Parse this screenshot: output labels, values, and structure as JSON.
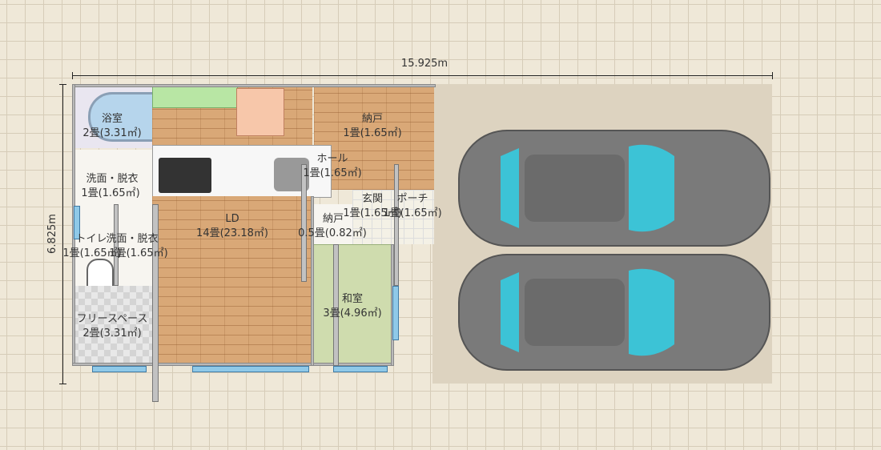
{
  "dimensions": {
    "width_label": "15.925m",
    "height_label": "6.825m"
  },
  "rooms": {
    "bath": {
      "name": "浴室",
      "size": "2畳(3.31㎡)"
    },
    "storage_upper": {
      "name": "納戸",
      "size": "1畳(1.65㎡)"
    },
    "hall": {
      "name": "ホール",
      "size": "1畳(1.65㎡)"
    },
    "washroom_upper": {
      "name": "洗面・脱衣",
      "size": "1畳(1.65㎡)"
    },
    "entrance": {
      "name": "玄関",
      "size": "1畳(1.65㎡)"
    },
    "porch": {
      "name": "ポーチ",
      "size": "1畳(1.65㎡)"
    },
    "ld": {
      "name": "LD",
      "size": "14畳(23.18㎡)"
    },
    "storage_lower": {
      "name": "納戸",
      "size": "0.5畳(0.82㎡)"
    },
    "toilet": {
      "name": "トイレ",
      "size": "1畳(1.65㎡)"
    },
    "washroom_lower": {
      "name": "洗面・脱衣",
      "size": "1畳(1.65㎡)"
    },
    "washitsu": {
      "name": "和室",
      "size": "3畳(4.96㎡)"
    },
    "free_space": {
      "name": "フリースペース",
      "size": "2畳(3.31㎡)"
    }
  },
  "colors": {
    "car_body": "#7a7a7a",
    "car_glass": "#3cc3d6",
    "wood_floor": "#d9a877",
    "tatami": "#cfdcae"
  }
}
